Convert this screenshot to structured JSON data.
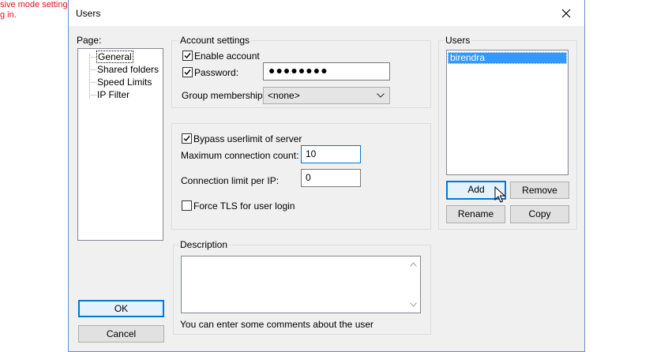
{
  "background": {
    "text": "sive mode setting\ng in."
  },
  "window": {
    "title": "Users",
    "close_icon": "close-icon"
  },
  "page_panel": {
    "label": "Page:",
    "items": [
      "General",
      "Shared folders",
      "Speed Limits",
      "IP Filter"
    ]
  },
  "account_settings": {
    "title": "Account settings",
    "enable_account_label": "Enable account",
    "enable_account_checked": true,
    "password_label": "Password:",
    "password_checked": true,
    "password_value": "●●●●●●●●",
    "group_membership_label": "Group membership:",
    "group_membership_value": "<none>"
  },
  "limits": {
    "bypass_label": "Bypass userlimit of server",
    "bypass_checked": true,
    "max_conn_label": "Maximum connection count:",
    "max_conn_value": "10",
    "conn_per_ip_label": "Connection limit per IP:",
    "conn_per_ip_value": "0",
    "force_tls_label": "Force TLS for user login",
    "force_tls_checked": false
  },
  "description": {
    "title": "Description",
    "value": "",
    "hint": "You can enter some comments about the user"
  },
  "users_panel": {
    "title": "Users",
    "users": [
      "birendra"
    ],
    "add_label": "Add",
    "remove_label": "Remove",
    "rename_label": "Rename",
    "copy_label": "Copy"
  },
  "buttons": {
    "ok_label": "OK",
    "cancel_label": "Cancel"
  },
  "colors": {
    "accent": "#0078d7",
    "selection": "#3399ff",
    "background_text": "#e81123"
  }
}
